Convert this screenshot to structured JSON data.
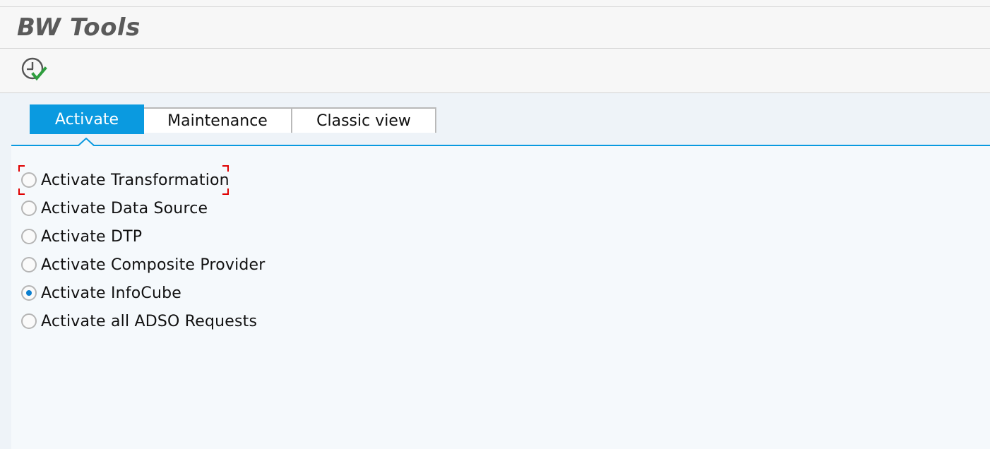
{
  "window": {
    "title": "BW Tools"
  },
  "toolbar": {
    "execute_icon": "execute-clock-check-icon"
  },
  "tabs": [
    {
      "label": "Activate",
      "active": true
    },
    {
      "label": "Maintenance",
      "active": false
    },
    {
      "label": "Classic view",
      "active": false
    }
  ],
  "options": [
    {
      "label": "Activate Transformation",
      "selected": false,
      "focused": true
    },
    {
      "label": "Activate Data Source",
      "selected": false
    },
    {
      "label": "Activate DTP",
      "selected": false
    },
    {
      "label": "Activate Composite Provider",
      "selected": false
    },
    {
      "label": "Activate InfoCube",
      "selected": true
    },
    {
      "label": "Activate all ADSO Requests",
      "selected": false
    }
  ],
  "colors": {
    "accent": "#0a9ae0",
    "focus": "#e00000",
    "check": "#2e9e3e"
  }
}
